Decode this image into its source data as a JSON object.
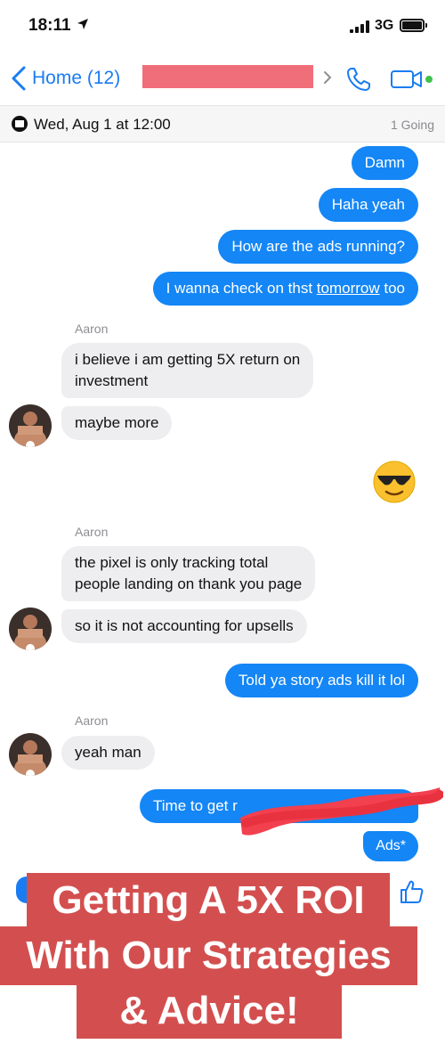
{
  "status_bar": {
    "time": "18:11",
    "network": "3G"
  },
  "nav": {
    "back_label": "Home (12)"
  },
  "event": {
    "date_text": "Wed, Aug 1 at 12:00",
    "going_text": "1 Going"
  },
  "messages": {
    "m1": "Damn",
    "m2": "Haha yeah",
    "m3": "How are the ads running?",
    "m4_pre": "I wanna check on thst ",
    "m4_link": "tomorrow",
    "m4_post": " too",
    "sender1": "Aaron",
    "m5_line1": "i believe i am getting 5X return on",
    "m5_line2": "investment",
    "m6": "maybe more",
    "sender2": "Aaron",
    "m7_line1": "the pixel is only tracking total",
    "m7_line2": "people landing on thank you page",
    "m8": "so it is not accounting for upsells",
    "m9": "Told ya story ads kill it lol",
    "sender3": "Aaron",
    "m10": "yeah man",
    "m11": "Time to get r",
    "m12": "Ads*"
  },
  "banner": {
    "line1": "Getting A 5X ROI",
    "line2": "With Our Strategies",
    "line3": "& Advice!"
  },
  "colors": {
    "accent": "#1a7cf2",
    "outgoing_bubble": "#1486f5",
    "incoming_bubble": "#eeeef0",
    "banner": "#d34f4f",
    "redaction": "#f06e7a",
    "online": "#3ec34a"
  },
  "icons": {
    "location": "location-arrow-icon",
    "back": "chevron-left-icon",
    "call": "phone-icon",
    "video": "video-camera-icon",
    "event": "calendar-icon",
    "like": "thumbs-up-icon"
  }
}
